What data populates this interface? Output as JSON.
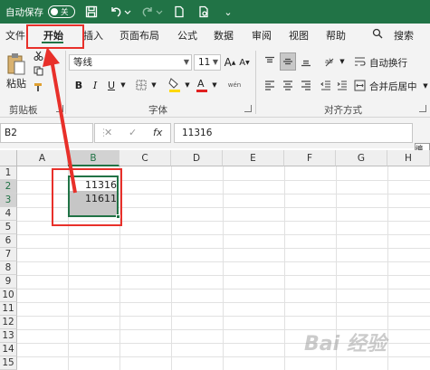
{
  "titlebar": {
    "autosave_label": "自动保存",
    "toggle_state": "关",
    "more_label": "⌄"
  },
  "tabs": [
    "文件",
    "开始",
    "插入",
    "页面布局",
    "公式",
    "数据",
    "审阅",
    "视图",
    "帮助"
  ],
  "active_tab": "开始",
  "search_label": "搜索",
  "ribbon": {
    "paste_label": "粘贴",
    "font_name": "等线",
    "font_size": "11",
    "grow_font": "A",
    "shrink_font": "A",
    "bold": "B",
    "italic": "I",
    "underline": "U",
    "wen": "wén",
    "wrap_text": "自动换行",
    "merge_center": "合并后居中",
    "groups": {
      "clipboard": "剪贴板",
      "font": "字体",
      "alignment": "对齐方式"
    }
  },
  "formula_bar": {
    "name_box": "B2",
    "cancel": "✕",
    "enter": "✓",
    "fx": "fx",
    "formula": "11316",
    "edit_hint": "编辑"
  },
  "sheet": {
    "columns": [
      "A",
      "B",
      "C",
      "D",
      "E",
      "F",
      "G",
      "H"
    ],
    "rows": [
      "1",
      "2",
      "3",
      "4",
      "5",
      "6",
      "7",
      "8",
      "9",
      "10",
      "11",
      "12",
      "13",
      "14",
      "15"
    ],
    "cells": {
      "B2": "11316",
      "B3": "11611"
    }
  },
  "watermark": "Bai 经验"
}
